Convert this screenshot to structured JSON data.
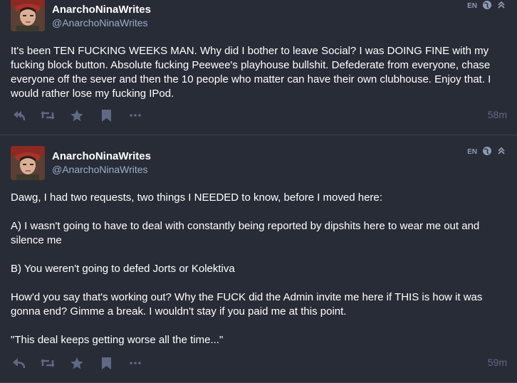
{
  "statuses": [
    {
      "display_name": "AnarchoNinaWrites",
      "handle": "@AnarchoNinaWrites",
      "language": "EN",
      "paragraphs": [
        "It's been TEN FUCKING WEEKS MAN. Why did I bother to leave Social? I was DOING FINE with my fucking block button. Absolute fucking Peewee's playhouse bullshit. Defederate from everyone, chase everyone off the sever and then the 10 people who matter can have their own clubhouse. Enjoy that. I would rather lose my fucking IPod."
      ],
      "timestamp": "58m",
      "icons": [
        "reply-all-icon",
        "boost-icon",
        "star-icon",
        "bookmark-icon",
        "more-icon"
      ]
    },
    {
      "display_name": "AnarchoNinaWrites",
      "handle": "@AnarchoNinaWrites",
      "language": "EN",
      "paragraphs": [
        "Dawg, I had two requests, two things I NEEDED to know, before I moved here:",
        "A) I wasn't going to have to deal with constantly being reported by dipshits here to wear me out and silence me",
        "B) You weren't going to defed Jorts or Kolektiva",
        "How'd you say that's working out? Why the FUCK did the Admin invite me here if THIS is how it was gonna end? Gimme a break. I wouldn't stay if you paid me at this point.",
        "\"This deal keeps getting worse all the time...\""
      ],
      "timestamp": "59m",
      "icons": [
        "reply-icon",
        "boost-icon",
        "star-icon",
        "bookmark-icon",
        "more-icon"
      ]
    }
  ],
  "colors": {
    "background": "#282c37",
    "text": "#ffffff",
    "secondary": "#9baec8",
    "action": "#606984",
    "divider": "#393f4f"
  }
}
